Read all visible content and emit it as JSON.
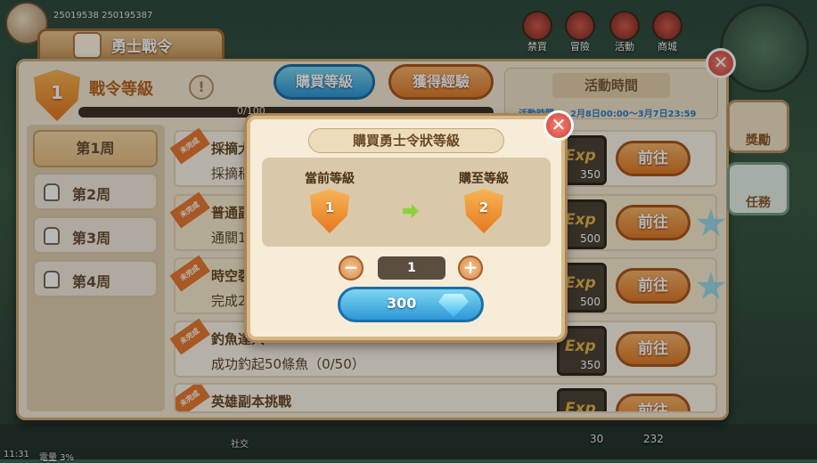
{
  "hud": {
    "player_ids": "25019538 250195387",
    "buttons": [
      "禁買",
      "冒險",
      "活動",
      "商城"
    ],
    "bottom_social": "社交",
    "bottom_count_left": "30",
    "bottom_count_right": "232",
    "clock": "11:31",
    "status": "電量 3%"
  },
  "window": {
    "title": "勇士戰令",
    "level_value": "1",
    "level_title": "戰令等級",
    "info_icon": "!",
    "progress_text": "0/100",
    "progress_fraction": 0.0,
    "buy_level_button": "購買等級",
    "get_exp_button": "獲得經驗",
    "time_header": "活動時間",
    "time_label": "活動時間：",
    "time_value": "2月8日00:00～3月7日23:59",
    "close_symbol": "✕"
  },
  "side_tabs": [
    {
      "label": "獎勵",
      "icon": "gift-icon"
    },
    {
      "label": "任務",
      "icon": "feather-icon"
    }
  ],
  "weeks": [
    {
      "label": "第1周",
      "locked": false
    },
    {
      "label": "第2周",
      "locked": true
    },
    {
      "label": "第3周",
      "locked": true
    },
    {
      "label": "第4周",
      "locked": true
    }
  ],
  "tasks": [
    {
      "ribbon": "未完成",
      "title": "採摘大",
      "desc": "採摘稻",
      "exp_word": "Exp",
      "exp": "350",
      "go": "前往"
    },
    {
      "ribbon": "未完成",
      "title": "普通副",
      "desc": "通關1",
      "exp_word": "Exp",
      "exp": "500",
      "go": "前往"
    },
    {
      "ribbon": "未完成",
      "title": "時空裂",
      "desc": "完成2",
      "exp_word": "Exp",
      "exp": "500",
      "go": "前往"
    },
    {
      "ribbon": "未完成",
      "title": "釣魚達人",
      "desc": "成功釣起50條魚（0/50）",
      "exp_word": "Exp",
      "exp": "350",
      "go": "前往"
    },
    {
      "ribbon": "未完成",
      "title": "英雄副本挑戰",
      "desc": "",
      "exp_word": "Exp",
      "exp": "",
      "go": "前往"
    }
  ],
  "modal": {
    "title": "購買勇士令狀等級",
    "current_label": "當前等級",
    "current_level": "1",
    "target_label": "購至等級",
    "target_level": "2",
    "minus": "−",
    "plus": "+",
    "quantity": "1",
    "price": "300",
    "close_symbol": "✕"
  },
  "colors": {
    "accent_orange": "#de7b2a",
    "accent_blue": "#2d98d6",
    "panel_bg": "#f4e9d4",
    "time_text": "#2f7fc8"
  }
}
